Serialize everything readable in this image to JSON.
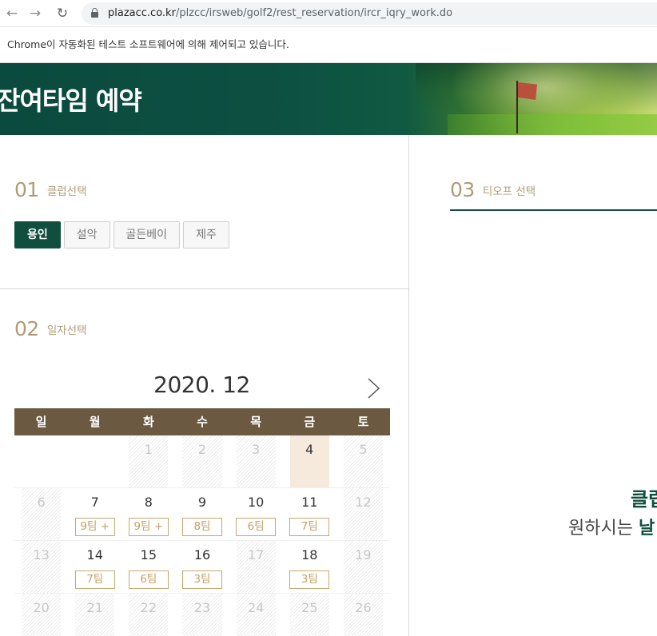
{
  "browser": {
    "url_host": "plazacc.co.kr",
    "url_path": "/plzcc/irsweb/golf2/rest_reservation/ircr_iqry_work.do",
    "infobar_text": "Chrome이 자동화된 테스트 소프트웨어에 의해 제어되고 있습니다."
  },
  "banner": {
    "title": "잔여타임 예약"
  },
  "club_section": {
    "num": "01",
    "label": "클럽선택",
    "clubs": [
      "용인",
      "설악",
      "골든베이",
      "제주"
    ],
    "active_index": 0
  },
  "date_section": {
    "num": "02",
    "label": "일자선택",
    "month_title": "2020. 12",
    "weekdays": [
      "일",
      "월",
      "화",
      "수",
      "목",
      "금",
      "토"
    ],
    "weeks": [
      [
        {
          "day": "",
          "off": false
        },
        {
          "day": "",
          "off": false
        },
        {
          "day": "1",
          "off": true
        },
        {
          "day": "2",
          "off": true
        },
        {
          "day": "3",
          "off": true
        },
        {
          "day": "4",
          "off": false,
          "today": true
        },
        {
          "day": "5",
          "off": true
        }
      ],
      [
        {
          "day": "6",
          "off": true
        },
        {
          "day": "7",
          "badge": "9팀 +"
        },
        {
          "day": "8",
          "badge": "9팀 +"
        },
        {
          "day": "9",
          "badge": "8팀"
        },
        {
          "day": "10",
          "badge": "6팀"
        },
        {
          "day": "11",
          "badge": "7팀"
        },
        {
          "day": "12",
          "off": true
        }
      ],
      [
        {
          "day": "13",
          "off": true
        },
        {
          "day": "14",
          "badge": "7팀"
        },
        {
          "day": "15",
          "badge": "6팀"
        },
        {
          "day": "16",
          "badge": "3팀"
        },
        {
          "day": "17",
          "off": true
        },
        {
          "day": "18",
          "badge": "3팀"
        },
        {
          "day": "19",
          "off": true
        }
      ],
      [
        {
          "day": "20",
          "off": true
        },
        {
          "day": "21",
          "off": true
        },
        {
          "day": "22",
          "off": true
        },
        {
          "day": "23",
          "off": true
        },
        {
          "day": "24",
          "off": true
        },
        {
          "day": "25",
          "off": true
        },
        {
          "day": "26",
          "off": true
        }
      ]
    ]
  },
  "tee_section": {
    "num": "03",
    "label": "티오프 선택",
    "message_line1": "클럽",
    "message_line2_prefix": "원하시는 ",
    "message_line2_bold": "날"
  }
}
